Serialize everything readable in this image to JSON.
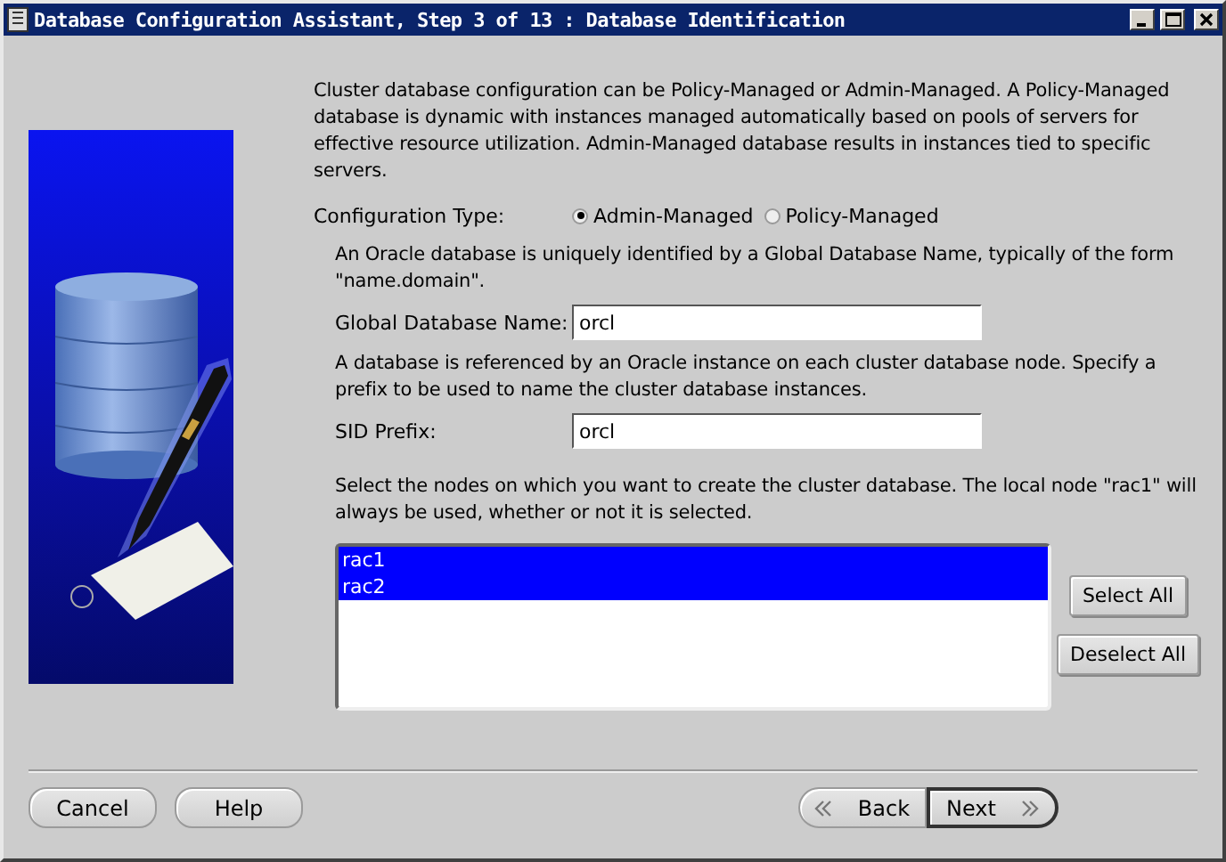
{
  "window": {
    "title": "Database Configuration Assistant, Step 3 of 13 : Database Identification"
  },
  "intro": "Cluster database configuration can be Policy-Managed or Admin-Managed. A Policy-Managed database is dynamic with instances managed automatically based on pools of servers for effective resource utilization. Admin-Managed database results in instances tied to specific servers.",
  "configuration_type": {
    "label": "Configuration Type:",
    "options": [
      {
        "label": "Admin-Managed",
        "selected": true
      },
      {
        "label": "Policy-Managed",
        "selected": false
      }
    ]
  },
  "global_name_hint": "An Oracle database is uniquely identified by a Global Database Name, typically of the form \"name.domain\".",
  "global_database_name": {
    "label": "Global Database Name:",
    "value": "orcl"
  },
  "sid_hint": "A database is referenced by an Oracle instance on each cluster database node. Specify a prefix to be used to name the cluster database instances.",
  "sid_prefix": {
    "label": "SID Prefix:",
    "value": "orcl"
  },
  "nodes_hint": "Select the nodes on which you want to create the cluster database. The local node \"rac1\" will always be used, whether or not it is selected.",
  "nodes": [
    {
      "label": "rac1",
      "selected": true
    },
    {
      "label": "rac2",
      "selected": true
    }
  ],
  "node_buttons": [
    "Select All",
    "Deselect All"
  ],
  "footer_buttons": [
    {
      "label": "Cancel",
      "kind": "plain"
    },
    {
      "label": "Help",
      "kind": "plain"
    },
    {
      "label": "Back",
      "kind": "back"
    },
    {
      "label": "Next",
      "kind": "next"
    }
  ]
}
